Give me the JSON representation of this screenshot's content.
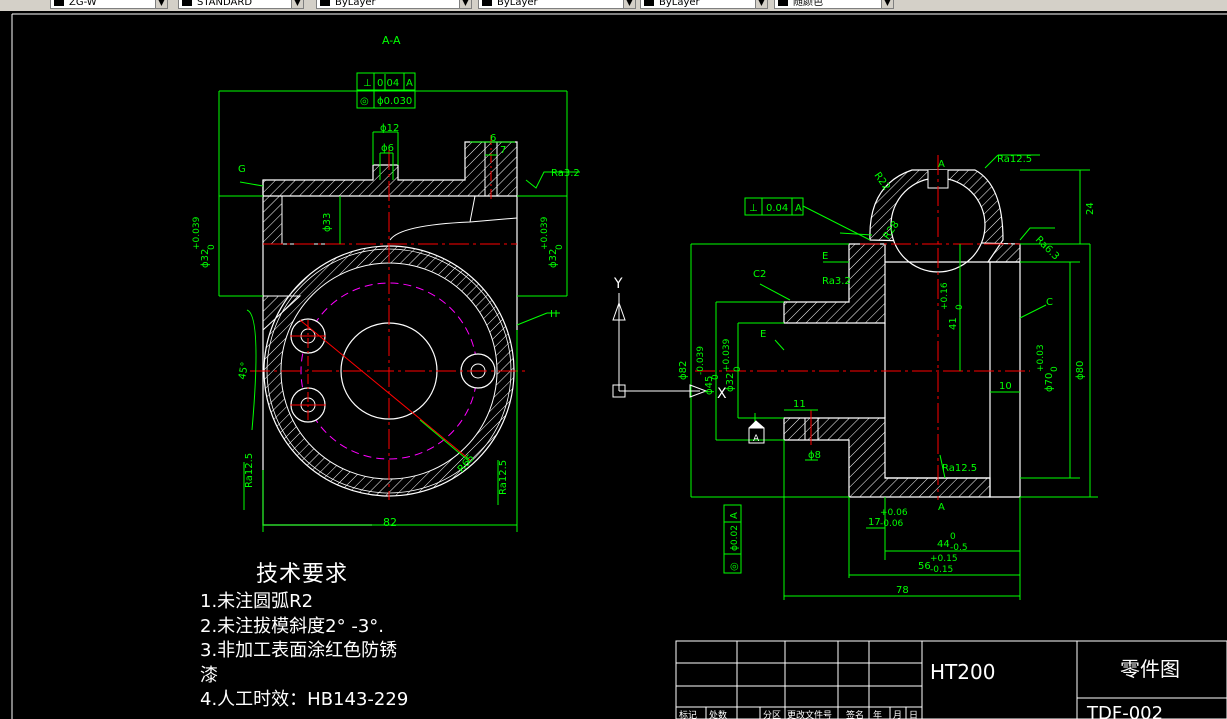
{
  "toolbar": {
    "combos": [
      {
        "name": "layer-combo",
        "value": "ZG-W"
      },
      {
        "name": "style-combo",
        "value": "STANDARD"
      },
      {
        "name": "color-combo",
        "value": "ByLayer"
      },
      {
        "name": "linetype-combo",
        "value": "ByLayer"
      },
      {
        "name": "lineweight-combo",
        "value": "ByLayer"
      },
      {
        "name": "plotstyle-combo",
        "value": "随颜色"
      }
    ]
  },
  "left_view": {
    "section_label": "A-A",
    "gtol_1_symbol": "⊥",
    "gtol_1_value": "0.04",
    "gtol_1_datum": "A",
    "gtol_2_symbol": "◎",
    "gtol_2_value": "ϕ0.030",
    "dim_phi12": "ϕ12",
    "dim_phi6": "ϕ6",
    "dim_6": "6",
    "dim_7": "7",
    "dim_phi33": "ϕ33",
    "dim_phi32_left": "ϕ32",
    "tol_left_upper": "+0.039",
    "tol_left_lower": "0",
    "dim_phi32_right": "ϕ32",
    "tol_right_upper": "+0.039",
    "tol_right_lower": "0",
    "rough_top": "Ra3.2",
    "label_g": "G",
    "label_h": "H",
    "angle_45": "45°",
    "dim_r65": "R65",
    "rough_left": "Ra12.5",
    "rough_right": "Ra12.5",
    "dim_82": "82"
  },
  "right_view": {
    "section_label_top": "A",
    "section_label_bottom": "A",
    "rough_top": "Ra12.5",
    "dim_r22": "R22",
    "dim_r28": "R28",
    "rough_r63": "Ra6.3",
    "dim_24": "24",
    "gtol_symbol": "⊥",
    "gtol_value": "0.04",
    "gtol_datum": "A",
    "label_e1": "E",
    "rough_e": "Ra3.2",
    "label_c2": "C2",
    "label_e2": "E",
    "label_c": "C",
    "dim_41_main": "41",
    "dim_41_upper": "+0.16",
    "dim_41_lower": "0",
    "dim_phi82": "ϕ82",
    "dim_phi45": "ϕ45",
    "dim_phi45_upper": "0",
    "dim_phi45_lower": "-0.039",
    "dim_phi32": "ϕ32",
    "dim_phi32_upper": "+0.039",
    "dim_phi32_lower": "0",
    "dim_phi70": "ϕ70",
    "dim_phi70_upper": "+0.03",
    "dim_phi70_lower": "0",
    "dim_phi80": "ϕ80",
    "dim_10": "10",
    "dim_11": "11",
    "dim_phi8": "ϕ8",
    "rough_bottom": "Ra12.5",
    "datum_a": "A",
    "gtol_vertical_symbol": "◎",
    "gtol_vertical_value": "ϕ0.02",
    "gtol_vertical_datum": "A",
    "dim_17": "17",
    "dim_17_upper": "+0.06",
    "dim_17_lower": "-0.06",
    "dim_44": "44",
    "dim_44_upper": "0",
    "dim_44_lower": "-0.5",
    "dim_56": "56",
    "dim_56_upper": "+0.15",
    "dim_56_lower": "-0.15",
    "dim_78": "78"
  },
  "ucs": {
    "y_label": "Y",
    "x_label": "X"
  },
  "notes": {
    "title": "技术要求",
    "lines": [
      "1.未注圆弧R2",
      "2.未注拔模斜度2° -3°.",
      "3.非加工表面涂红色防锈",
      "漆",
      "4.人工时效：HB143-229"
    ]
  },
  "title_block": {
    "material": "HT200",
    "drawing_title": "零件图",
    "drawing_no": "TDF-002",
    "header_cells": [
      "标记",
      "处数",
      "分区",
      "更改文件号",
      "签名",
      "年",
      "月",
      "日"
    ]
  },
  "colors": {
    "outline": "#ffffff",
    "dimension": "#00ff00",
    "centerline": "#ff0000",
    "hidden": "#ff00ff",
    "background": "#000000"
  }
}
